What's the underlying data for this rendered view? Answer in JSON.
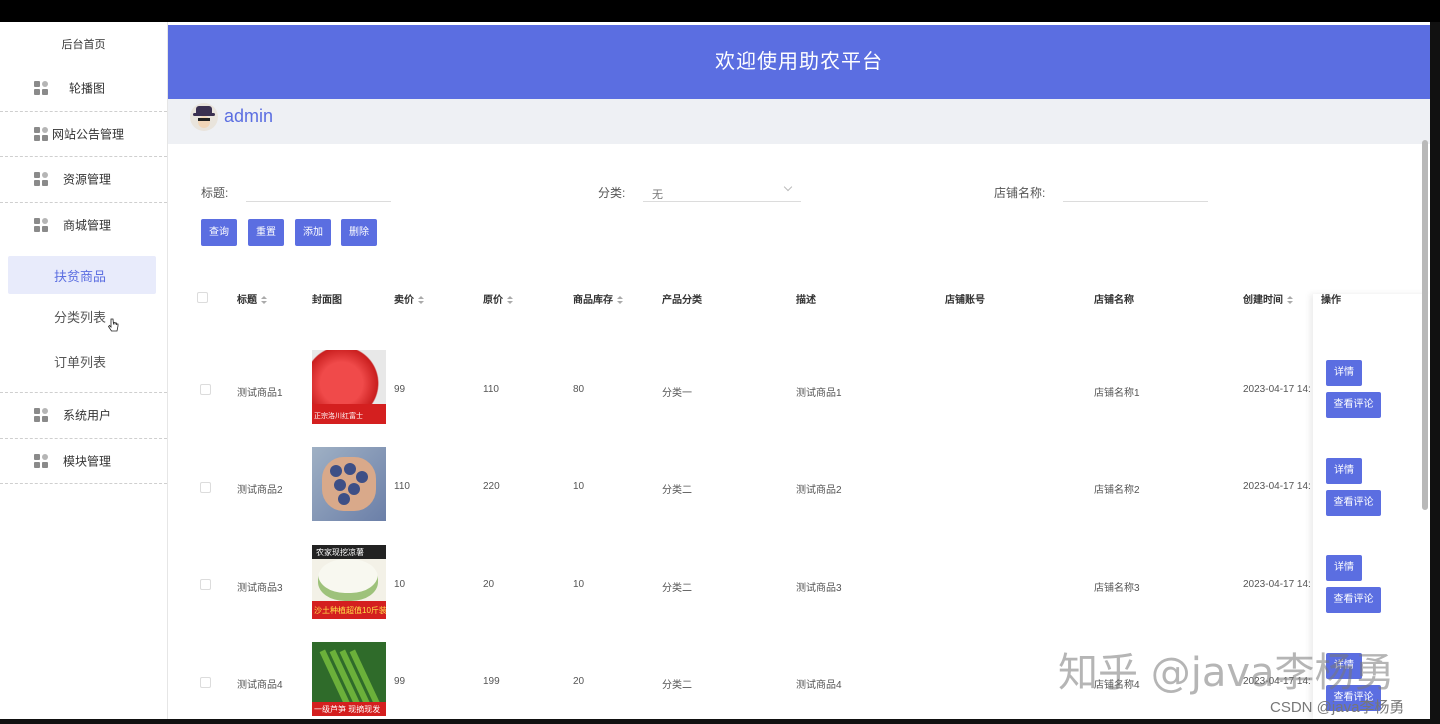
{
  "sidebar": {
    "home": "后台首页",
    "items": [
      {
        "label": "轮播图"
      },
      {
        "label": "网站公告管理"
      },
      {
        "label": "资源管理"
      },
      {
        "label": "商城管理"
      }
    ],
    "sub_items": [
      {
        "label": "扶贫商品",
        "active": true
      },
      {
        "label": "分类列表"
      },
      {
        "label": "订单列表"
      }
    ],
    "items2": [
      {
        "label": "系统用户"
      },
      {
        "label": "模块管理"
      }
    ]
  },
  "header": {
    "title": "欢迎使用助农平台"
  },
  "user": {
    "name": "admin"
  },
  "filters": {
    "title_label": "标题:",
    "category_label": "分类:",
    "category_value": "无",
    "shop_label": "店铺名称:"
  },
  "buttons": {
    "query": "查询",
    "reset": "重置",
    "add": "添加",
    "delete": "删除"
  },
  "table": {
    "headers": [
      "标题",
      "封面图",
      "卖价",
      "原价",
      "商品库存",
      "产品分类",
      "描述",
      "店铺账号",
      "店铺名称",
      "创建时间",
      "操作"
    ],
    "rows": [
      {
        "title": "测试商品1",
        "price": "99",
        "original": "110",
        "stock": "80",
        "category": "分类一",
        "desc": "测试商品1",
        "account": "",
        "shop": "店铺名称1",
        "created": "2023-04-17 14:",
        "cover": "apple"
      },
      {
        "title": "测试商品2",
        "price": "110",
        "original": "220",
        "stock": "10",
        "category": "分类二",
        "desc": "测试商品2",
        "account": "",
        "shop": "店铺名称2",
        "created": "2023-04-17 14:",
        "cover": "blueberry"
      },
      {
        "title": "测试商品3",
        "price": "10",
        "original": "20",
        "stock": "10",
        "category": "分类二",
        "desc": "测试商品3",
        "account": "",
        "shop": "店铺名称3",
        "created": "2023-04-17 14:",
        "cover": "melon"
      },
      {
        "title": "测试商品4",
        "price": "99",
        "original": "199",
        "stock": "20",
        "category": "分类二",
        "desc": "测试商品4",
        "account": "",
        "shop": "店铺名称4",
        "created": "2023-04-17 14:",
        "cover": "asparagus"
      }
    ],
    "detail_label": "详情",
    "comment_label": "查看评论"
  },
  "cover_text": {
    "apple": "正宗洛川红富士",
    "melon_top": "农家现挖凉薯",
    "melon_bottom": "沙土种植超值10斤装",
    "asparagus": "一级芦笋 现摘现发"
  },
  "watermark": "知乎 @java李杨勇",
  "csdn": "CSDN @java李杨勇"
}
